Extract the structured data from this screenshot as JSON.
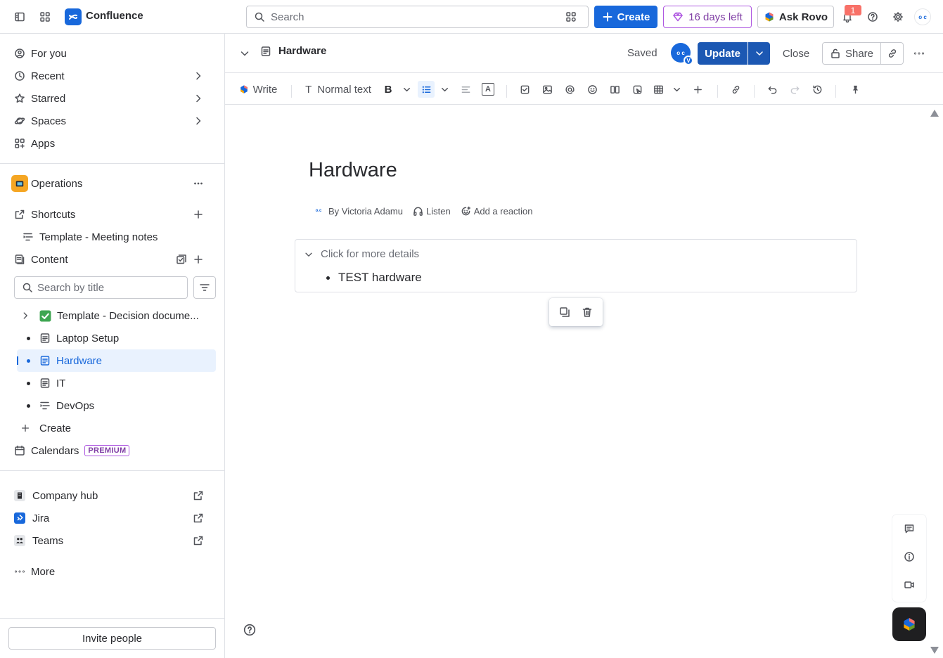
{
  "app": {
    "name": "Confluence"
  },
  "topbar": {
    "search_placeholder": "Search",
    "create_label": "Create",
    "trial_label": "16 days left",
    "ask_rovo_label": "Ask Rovo",
    "notification_count": "1",
    "avatar_initials": "o c"
  },
  "sidebar": {
    "nav": [
      {
        "label": "For you"
      },
      {
        "label": "Recent"
      },
      {
        "label": "Starred"
      },
      {
        "label": "Spaces"
      },
      {
        "label": "Apps"
      }
    ],
    "space": {
      "name": "Operations"
    },
    "shortcuts": {
      "label": "Shortcuts",
      "items": [
        {
          "label": "Template - Meeting notes"
        }
      ]
    },
    "content": {
      "label": "Content",
      "search_placeholder": "Search by title",
      "tree": [
        {
          "label": "Template - Decision docume...",
          "icon": "check-emoji"
        },
        {
          "label": "Laptop Setup",
          "icon": "page-icon"
        },
        {
          "label": "Hardware",
          "icon": "page-icon",
          "selected": true
        },
        {
          "label": "IT",
          "icon": "page-icon"
        },
        {
          "label": "DevOps",
          "icon": "list-page-icon"
        }
      ],
      "create_label": "Create"
    },
    "calendars": {
      "label": "Calendars",
      "badge": "PREMIUM"
    },
    "apps": [
      {
        "label": "Company hub"
      },
      {
        "label": "Jira"
      },
      {
        "label": "Teams"
      }
    ],
    "more_label": "More",
    "invite_label": "Invite people"
  },
  "page_header": {
    "title": "Hardware",
    "status": "Saved",
    "collab_initials": "o c",
    "collab_badge": "V",
    "update_label": "Update",
    "close_label": "Close",
    "share_label": "Share"
  },
  "toolbar": {
    "write_label": "Write",
    "text_style_label": "Normal text",
    "text_style_glyph": "T",
    "bold_glyph": "B",
    "color_glyph": "A"
  },
  "document": {
    "title": "Hardware",
    "author_avatar": "o.c",
    "byline": "By Victoria Adamu",
    "listen_label": "Listen",
    "reaction_label": "Add a reaction",
    "expand": {
      "title": "Click for more details",
      "items": [
        "TEST hardware"
      ]
    }
  },
  "colors": {
    "brand": "#1868db",
    "update_button": "#1c58b3",
    "premium": "#af59e1",
    "selected_bg": "#e9f2fe"
  }
}
